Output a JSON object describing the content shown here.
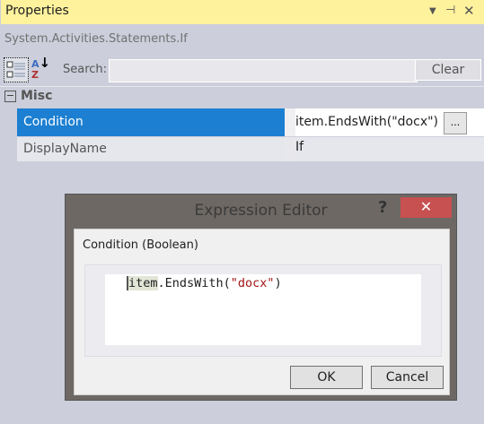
{
  "panel": {
    "title": "Properties",
    "subtitle": "System.Activities.Statements.If",
    "search_label": "Search:",
    "search_value": "",
    "clear_label": "Clear",
    "category": "Misc",
    "properties": [
      {
        "name": "Condition",
        "value": "item.EndsWith(\"docx\")",
        "selected": true
      },
      {
        "name": "DisplayName",
        "value": "If"
      }
    ],
    "ellipsis": "...",
    "az_top": "A",
    "az_bottom": "Z"
  },
  "dialog": {
    "title": "Expression Editor",
    "help": "?",
    "close": "✕",
    "label": "Condition (Boolean)",
    "code": {
      "ident": "item",
      "rest": ".EndsWith(",
      "string": "\"docx\"",
      "end": ")"
    },
    "ok_label": "OK",
    "cancel_label": "Cancel"
  },
  "colors": {
    "titlebar": "#fff29d",
    "selection": "#1c7fd1",
    "close": "#c75050"
  }
}
